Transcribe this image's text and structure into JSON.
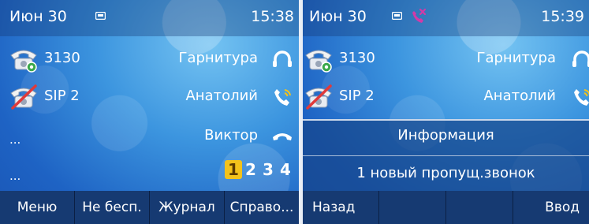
{
  "left": {
    "status": {
      "date": "Июн 30",
      "time": "15:38"
    },
    "lines": [
      {
        "label": "3130",
        "right_label": "Гарнитура",
        "right_icon": "headset-icon",
        "status": "registered"
      },
      {
        "label": "SIP 2",
        "right_label": "Анатолий",
        "right_icon": "phone-ring-icon",
        "status": "unregistered"
      },
      {
        "label": "...",
        "right_label": "Виктор",
        "right_icon": "handset-icon"
      },
      {
        "label": "..."
      }
    ],
    "pages": [
      "1",
      "2",
      "3",
      "4"
    ],
    "active_page": "1",
    "softkeys": [
      "Меню",
      "Не бесп.",
      "Журнал",
      "Справо..."
    ]
  },
  "right": {
    "status": {
      "date": "Июн 30",
      "time": "15:39"
    },
    "lines": [
      {
        "label": "3130",
        "right_label": "Гарнитура",
        "right_icon": "headset-icon"
      },
      {
        "label": "SIP 2",
        "right_label": "Анатолий",
        "right_icon": "phone-ring-icon"
      }
    ],
    "info": {
      "title": "Информация",
      "message": "1 новый пропущ.звонок"
    },
    "softkeys": [
      "Назад",
      "",
      "",
      "Ввод"
    ]
  },
  "colors": {
    "active_page_bg": "#f3c21b",
    "missed_call_icon": "#d33aa7",
    "registered_dot": "#3aa84a",
    "unregistered_slash": "#e03a3a"
  }
}
